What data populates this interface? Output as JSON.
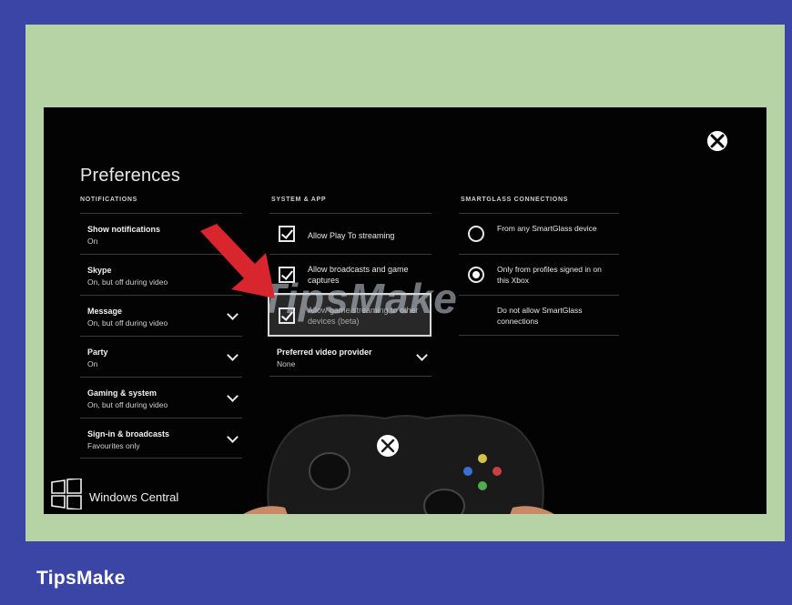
{
  "screen": {
    "title": "Preferences",
    "brand_overlay": "Windows Central",
    "watermark": "TipsMake"
  },
  "notifications": {
    "heading": "NOTIFICATIONS",
    "items": [
      {
        "label": "Show notifications",
        "value": "On",
        "expandable": false
      },
      {
        "label": "Skype",
        "value": "On, but off during video",
        "expandable": false
      },
      {
        "label": "Message",
        "value": "On, but off during video",
        "expandable": true
      },
      {
        "label": "Party",
        "value": "On",
        "expandable": true
      },
      {
        "label": "Gaming & system",
        "value": "On, but off during video",
        "expandable": true
      },
      {
        "label": "Sign-in & broadcasts",
        "value": "Favourites only",
        "expandable": true
      }
    ]
  },
  "system_app": {
    "heading": "SYSTEM & APP",
    "checkboxes": [
      {
        "label": "Allow Play To streaming",
        "checked": true
      },
      {
        "label": "Allow broadcasts and game captures",
        "checked": true
      },
      {
        "label": "Allow game streaming to other devices (beta)",
        "checked": true
      }
    ],
    "provider_label": "Preferred video provider",
    "provider_value": "None"
  },
  "smartglass": {
    "heading": "SMARTGLASS CONNECTIONS",
    "options": [
      {
        "label": "From any SmartGlass device",
        "selected": false
      },
      {
        "label": "Only from profiles signed in on this Xbox",
        "selected": true
      },
      {
        "label": "Do not allow SmartGlass connections",
        "selected": false
      }
    ]
  },
  "footer": {
    "brand": "TipsMake"
  },
  "colors": {
    "frame": "#3a45a6",
    "panel": "#b6d3a6",
    "screen": "#030303",
    "arrow": "#d9262e"
  }
}
